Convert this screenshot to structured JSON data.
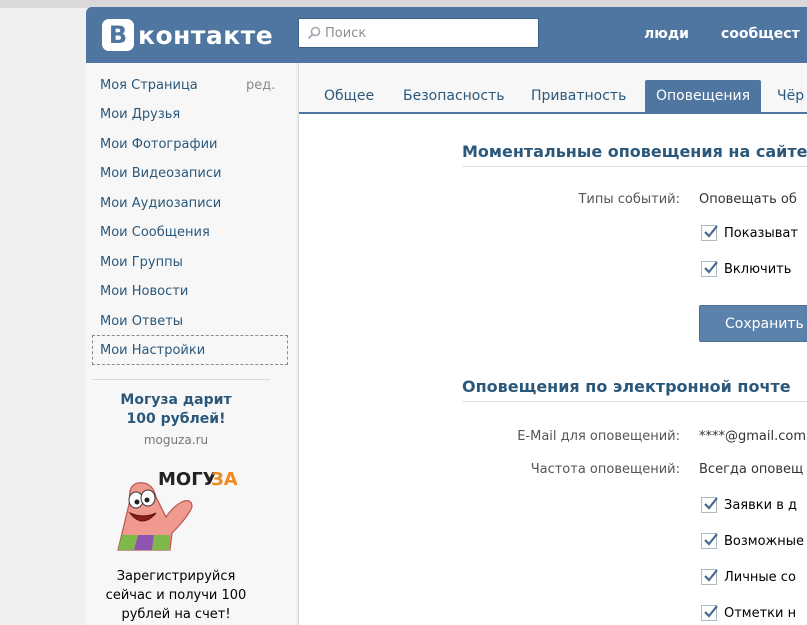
{
  "header": {
    "logo_letter": "В",
    "logo_text": "контакте",
    "search_placeholder": "Поиск",
    "links": [
      "люди",
      "сообщест"
    ]
  },
  "sidebar": {
    "edit_label": "ред.",
    "items": [
      "Моя Страница",
      "Мои Друзья",
      "Мои Фотографии",
      "Мои Видеозаписи",
      "Мои Аудиозаписи",
      "Мои Сообщения",
      "Мои Группы",
      "Мои Новости",
      "Мои Ответы",
      "Мои Настройки"
    ],
    "selected_index": 9
  },
  "ad": {
    "title_line1": "Могуза дарит",
    "title_line2": "100 рублей!",
    "domain": "moguza.ru",
    "logo_text": "МОГУЗА",
    "text_line1": "Зарегистрируйся",
    "text_line2": "сейчас и получи 100",
    "text_line3": "рублей на счет!"
  },
  "tabs": {
    "items": [
      "Общее",
      "Безопасность",
      "Приватность",
      "Оповещения",
      "Чёр"
    ],
    "active_index": 3
  },
  "instant": {
    "title": "Моментальные оповещения на сайте",
    "event_types_label": "Типы событий:",
    "event_types_value": "Оповещать об",
    "checkboxes": [
      {
        "label": "Показыват",
        "checked": true
      },
      {
        "label": "Включить",
        "checked": true
      }
    ],
    "save_button": "Сохранить"
  },
  "email": {
    "title": "Оповещения по электронной почте",
    "address_label": "E-Mail для оповещений:",
    "address_value": "****@gmail.com",
    "frequency_label": "Частота оповещений:",
    "frequency_value": "Всегда оповещ",
    "checkboxes": [
      {
        "label": "Заявки в д",
        "checked": true
      },
      {
        "label": "Возможные",
        "checked": true
      },
      {
        "label": "Личные со",
        "checked": true
      },
      {
        "label": "Отметки н",
        "checked": true
      }
    ]
  },
  "colors": {
    "brand": "#4f76a1",
    "link": "#2b587a",
    "button": "#5b82ab"
  }
}
